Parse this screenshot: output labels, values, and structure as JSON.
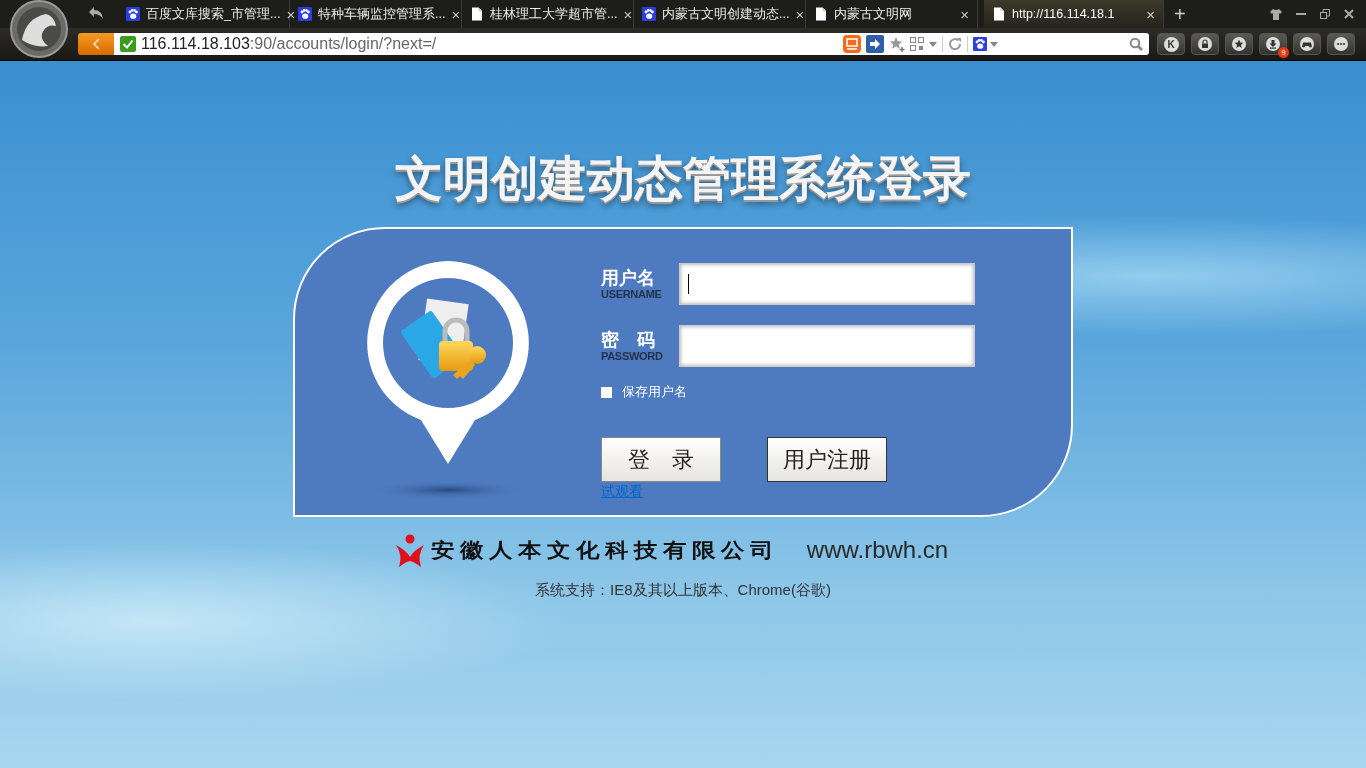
{
  "browser": {
    "tabs": [
      {
        "label": "百度文库搜索_市管理...",
        "kind": "paw",
        "selected": false
      },
      {
        "label": "特种车辆监控管理系...",
        "kind": "paw",
        "selected": false
      },
      {
        "label": "桂林理工大学超市管...",
        "kind": "page",
        "selected": false
      },
      {
        "label": "内蒙古文明创建动态...",
        "kind": "paw",
        "selected": false
      },
      {
        "label": "内蒙古文明网",
        "kind": "page",
        "selected": false
      },
      {
        "label": "http://116.114.18.1",
        "kind": "page",
        "selected": true
      }
    ],
    "close_glyph": "×",
    "new_tab_glyph": "+",
    "address": {
      "host": "116.114.18.103",
      "rest": ":90/accounts/login/?next=/"
    },
    "toolbar": [
      {
        "kind": "letter",
        "label": "K"
      },
      {
        "kind": "lock"
      },
      {
        "kind": "star"
      },
      {
        "kind": "download",
        "badge": "9"
      },
      {
        "kind": "gamepad"
      },
      {
        "kind": "more"
      }
    ]
  },
  "page": {
    "title": "文明创建动态管理系统登录",
    "login": {
      "username": {
        "label": "用户名",
        "sublabel": "USERNAME",
        "focused": true
      },
      "password": {
        "label": "密　码",
        "sublabel": "PASSWORD"
      },
      "remember": {
        "label": "保存用户名",
        "checked": false
      },
      "buttons": [
        {
          "kind": "login",
          "label": "登　录"
        },
        {
          "kind": "register",
          "label": "用户注册"
        }
      ],
      "demo_link": "试观看"
    },
    "footer": {
      "company": "安徽人本文化科技有限公司",
      "website": "www.rbwh.cn",
      "support": "系统支持：IE8及其以上版本、Chrome(谷歌)"
    }
  }
}
